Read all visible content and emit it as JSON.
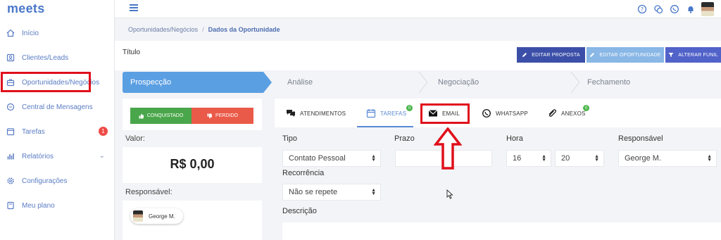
{
  "app": {
    "logo": "meets"
  },
  "sidebar": {
    "items": [
      {
        "label": "Início",
        "icon": "home-icon"
      },
      {
        "label": "Clientes/Leads",
        "icon": "contacts-icon"
      },
      {
        "label": "Oportunidades/Negócios",
        "icon": "briefcase-icon"
      },
      {
        "label": "Central de Mensagens",
        "icon": "chat-icon"
      },
      {
        "label": "Tarefas",
        "icon": "tasks-icon",
        "badge": "1"
      },
      {
        "label": "Relatórios",
        "icon": "bar-chart-icon"
      },
      {
        "label": "Configurações",
        "icon": "gear-icon"
      },
      {
        "label": "Meu plano",
        "icon": "plan-icon"
      }
    ]
  },
  "breadcrumb": {
    "parent": "Oportunidades/Negócios",
    "sep": "/",
    "current": "Dados da Oportunidade"
  },
  "header": {
    "title": "Título",
    "buttons": {
      "edit_proposal": "EDITAR PROPOSTA",
      "edit_opportunity": "EDITAR OPORTUNIDADE",
      "change_funnel": "ALTERAR FUNIL"
    }
  },
  "pipeline": {
    "stages": [
      "Prospecção",
      "Análise",
      "Negociação",
      "Fechamento"
    ],
    "active": "Prospecção"
  },
  "deal": {
    "won_label": "CONQUISTADO",
    "lost_label": "PERDIDO",
    "value_label": "Valor:",
    "value": "R$ 0,00",
    "owner_label": "Responsável:",
    "owner": "George M."
  },
  "tabs": {
    "atendimentos": "ATENDIMENTOS",
    "tarefas": "TAREFAS",
    "tarefas_badge": "0",
    "email": "EMAIL",
    "whatsapp": "WHATSAPP",
    "anexos": "ANEXOS",
    "anexos_badge": "0"
  },
  "form": {
    "tipo_label": "Tipo",
    "tipo_value": "Contato Pessoal",
    "prazo_label": "Prazo",
    "hora_label": "Hora",
    "hora_h": "16",
    "hora_m": "20",
    "resp_label": "Responsável",
    "resp_value": "George M.",
    "recorrencia_label": "Recorrência",
    "recorrencia_value": "Não se repete",
    "descricao_label": "Descrição"
  },
  "colors": {
    "accent": "#4a78c9",
    "highlight": "#e0101b",
    "stage_active": "#5b9fe3",
    "won": "#4aa64a",
    "lost": "#ea5a49"
  }
}
